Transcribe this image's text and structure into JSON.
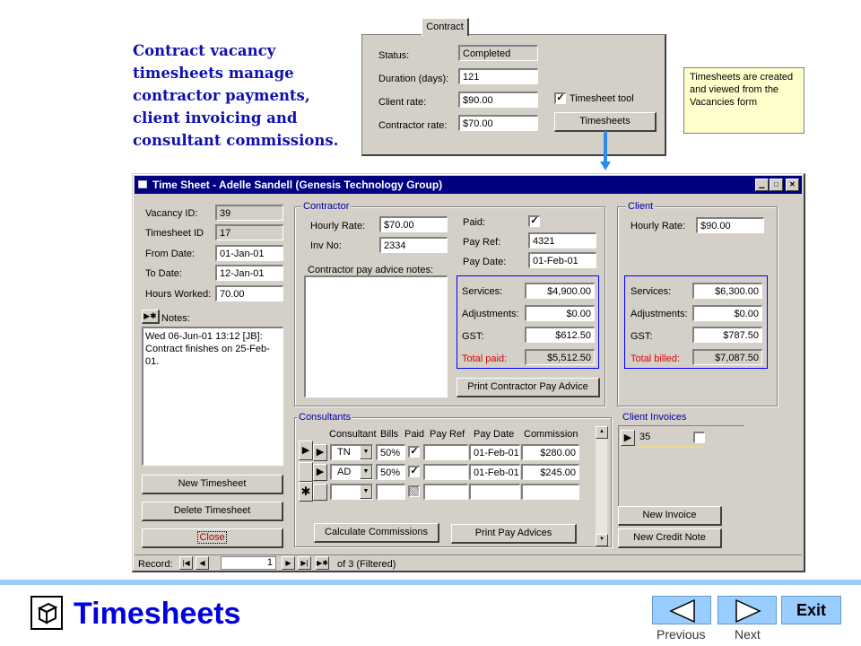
{
  "slide": {
    "heading": "Contract vacancy timesheets manage contractor payments, client invoicing and consultant commissions.",
    "note": "Timesheets are created and viewed from the Vacancies form",
    "title": "Timesheets",
    "exit_label": "Exit",
    "previous_label": "Previous",
    "next_label": "Next",
    "colors": {
      "title_blue": "#0000e0",
      "heading_blue": "#1010b0",
      "accent_bar": "#99ccff",
      "note_bg": "#ffffcc",
      "arrow": "#2a8cf0"
    }
  },
  "contract_panel": {
    "tab": "Contract",
    "status_label": "Status:",
    "status": "Completed",
    "duration_label": "Duration (days):",
    "duration": "121",
    "client_rate_label": "Client rate:",
    "client_rate": "$90.00",
    "contractor_rate_label": "Contractor rate:",
    "contractor_rate": "$70.00",
    "timesheet_tool_label": "Timesheet tool",
    "timesheets_button": "Timesheets"
  },
  "window": {
    "title": "Time Sheet - Adelle Sandell (Genesis Technology Group)",
    "vacancy_id_label": "Vacancy ID:",
    "vacancy_id": "39",
    "timesheet_id_label": "Timesheet ID",
    "timesheet_id": "17",
    "from_date_label": "From Date:",
    "from_date": "01-Jan-01",
    "to_date_label": "To Date:",
    "to_date": "12-Jan-01",
    "hours_label": "Hours Worked:",
    "hours": "70.00",
    "notes_label": "Notes:",
    "notes": "Wed 06-Jun-01 13:12 [JB]: Contract finishes on 25-Feb-01.",
    "new_timesheet": "New Timesheet",
    "delete_timesheet": "Delete Timesheet",
    "close": "Close",
    "contractor": {
      "title": "Contractor",
      "hourly_label": "Hourly Rate:",
      "hourly": "$70.00",
      "inv_label": "Inv No:",
      "inv": "2334",
      "paid_label": "Paid:",
      "payref_label": "Pay Ref:",
      "payref": "4321",
      "paydate_label": "Pay Date:",
      "paydate": "01-Feb-01",
      "notes_label": "Contractor pay advice notes:",
      "services_label": "Services:",
      "services": "$4,900.00",
      "adjustments_label": "Adjustments:",
      "adjustments": "$0.00",
      "gst_label": "GST:",
      "gst": "$612.50",
      "total_label": "Total paid:",
      "total": "$5,512.50",
      "print_button": "Print Contractor Pay Advice"
    },
    "client": {
      "title": "Client",
      "hourly_label": "Hourly Rate:",
      "hourly": "$90.00",
      "services_label": "Services:",
      "services": "$6,300.00",
      "adjustments_label": "Adjustments:",
      "adjustments": "$0.00",
      "gst_label": "GST:",
      "gst": "$787.50",
      "total_label": "Total billed:",
      "total": "$7,087.50"
    },
    "consultants": {
      "title": "Consultants",
      "headers": [
        "Consultant",
        "Bills",
        "Paid",
        "Pay Ref",
        "Pay Date",
        "Commission"
      ],
      "rows": [
        {
          "consultant": "TN",
          "bills": "50%",
          "paid": true,
          "payref": "",
          "paydate": "01-Feb-01",
          "commission": "$280.00"
        },
        {
          "consultant": "AD",
          "bills": "50%",
          "paid": true,
          "payref": "",
          "paydate": "01-Feb-01",
          "commission": "$245.00"
        }
      ],
      "calc_button": "Calculate Commissions",
      "print_button": "Print Pay Advices"
    },
    "client_invoices": {
      "title": "Client Invoices",
      "invoice": "35",
      "new_invoice": "New Invoice",
      "new_credit": "New Credit Note"
    },
    "record_nav": {
      "label": "Record:",
      "current": "1",
      "of_text": "of  3 (Filtered)"
    }
  }
}
